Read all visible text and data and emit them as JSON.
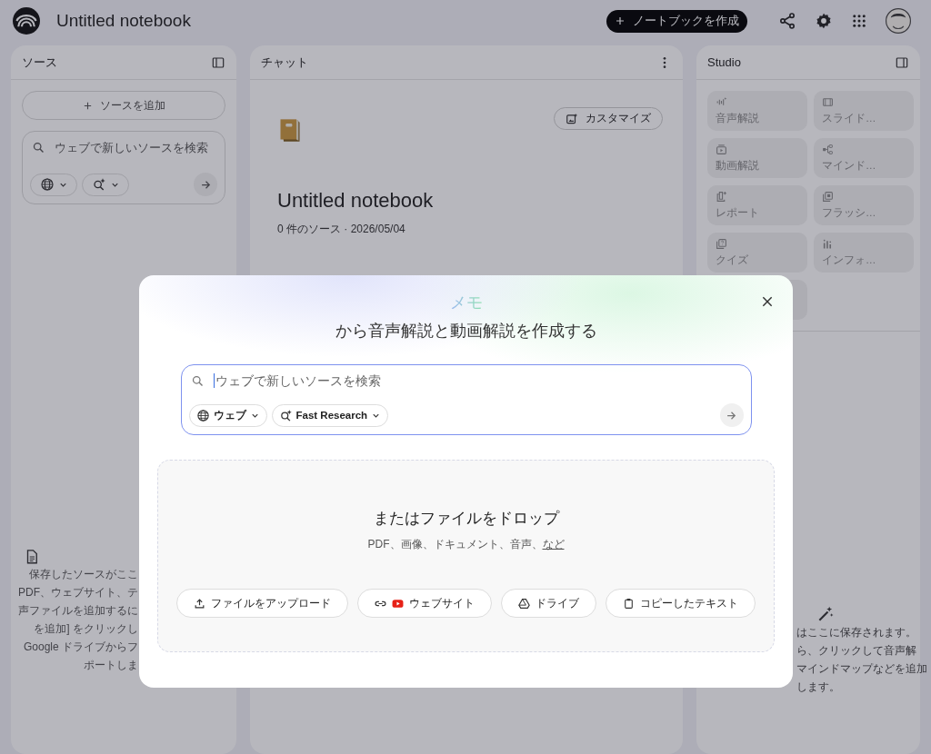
{
  "app": {
    "title": "Untitled notebook",
    "create_button": "ノートブックを作成"
  },
  "sources": {
    "title": "ソース",
    "add_button": "ソースを追加",
    "search": {
      "placeholder": "ウェブで新しいソースを検索"
    },
    "empty_lines": [
      "保存したソースがここ",
      "PDF、ウェブサイト、テ",
      "声ファイルを追加するに",
      "を追加] をクリックし",
      "Google ドライブからフ",
      "ポートしま"
    ]
  },
  "chat": {
    "title": "チャット",
    "customize_button": "カスタマイズ",
    "notebook_title": "Untitled notebook",
    "meta": "0 件のソース · 2026/05/04"
  },
  "studio": {
    "title": "Studio",
    "tiles": [
      {
        "kind": "audio",
        "label": "音声解説"
      },
      {
        "kind": "slides",
        "label": "スライド…"
      },
      {
        "kind": "video",
        "label": "動画解説"
      },
      {
        "kind": "mindmap",
        "label": "マインド…"
      },
      {
        "kind": "report",
        "label": "レポート"
      },
      {
        "kind": "flashcards",
        "label": "フラッシ…"
      },
      {
        "kind": "quiz",
        "label": "クイズ"
      },
      {
        "kind": "infographic",
        "label": "インフォ…"
      },
      {
        "kind": "blank"
      }
    ],
    "empty_lines": [
      "はここに保存されます。",
      "ら、クリックして音声解",
      "マインドマップなどを追加",
      "します。"
    ]
  },
  "dialog": {
    "brand": "メモ",
    "heading": "から音声解説と動画解説を作成する",
    "search": {
      "placeholder": "ウェブで新しいソースを検索",
      "source_chip": "ウェブ",
      "mode_chip": "Fast Research"
    },
    "drop": {
      "title": "またはファイルをドロップ",
      "hint": "PDF、画像、ドキュメント、音声、",
      "hint_link": "など",
      "buttons": [
        {
          "kind": "upload",
          "label": "ファイルをアップロード"
        },
        {
          "kind": "website",
          "label": "ウェブサイト"
        },
        {
          "kind": "drive",
          "label": "ドライブ"
        },
        {
          "kind": "paste",
          "label": "コピーしたテキスト"
        }
      ]
    }
  }
}
